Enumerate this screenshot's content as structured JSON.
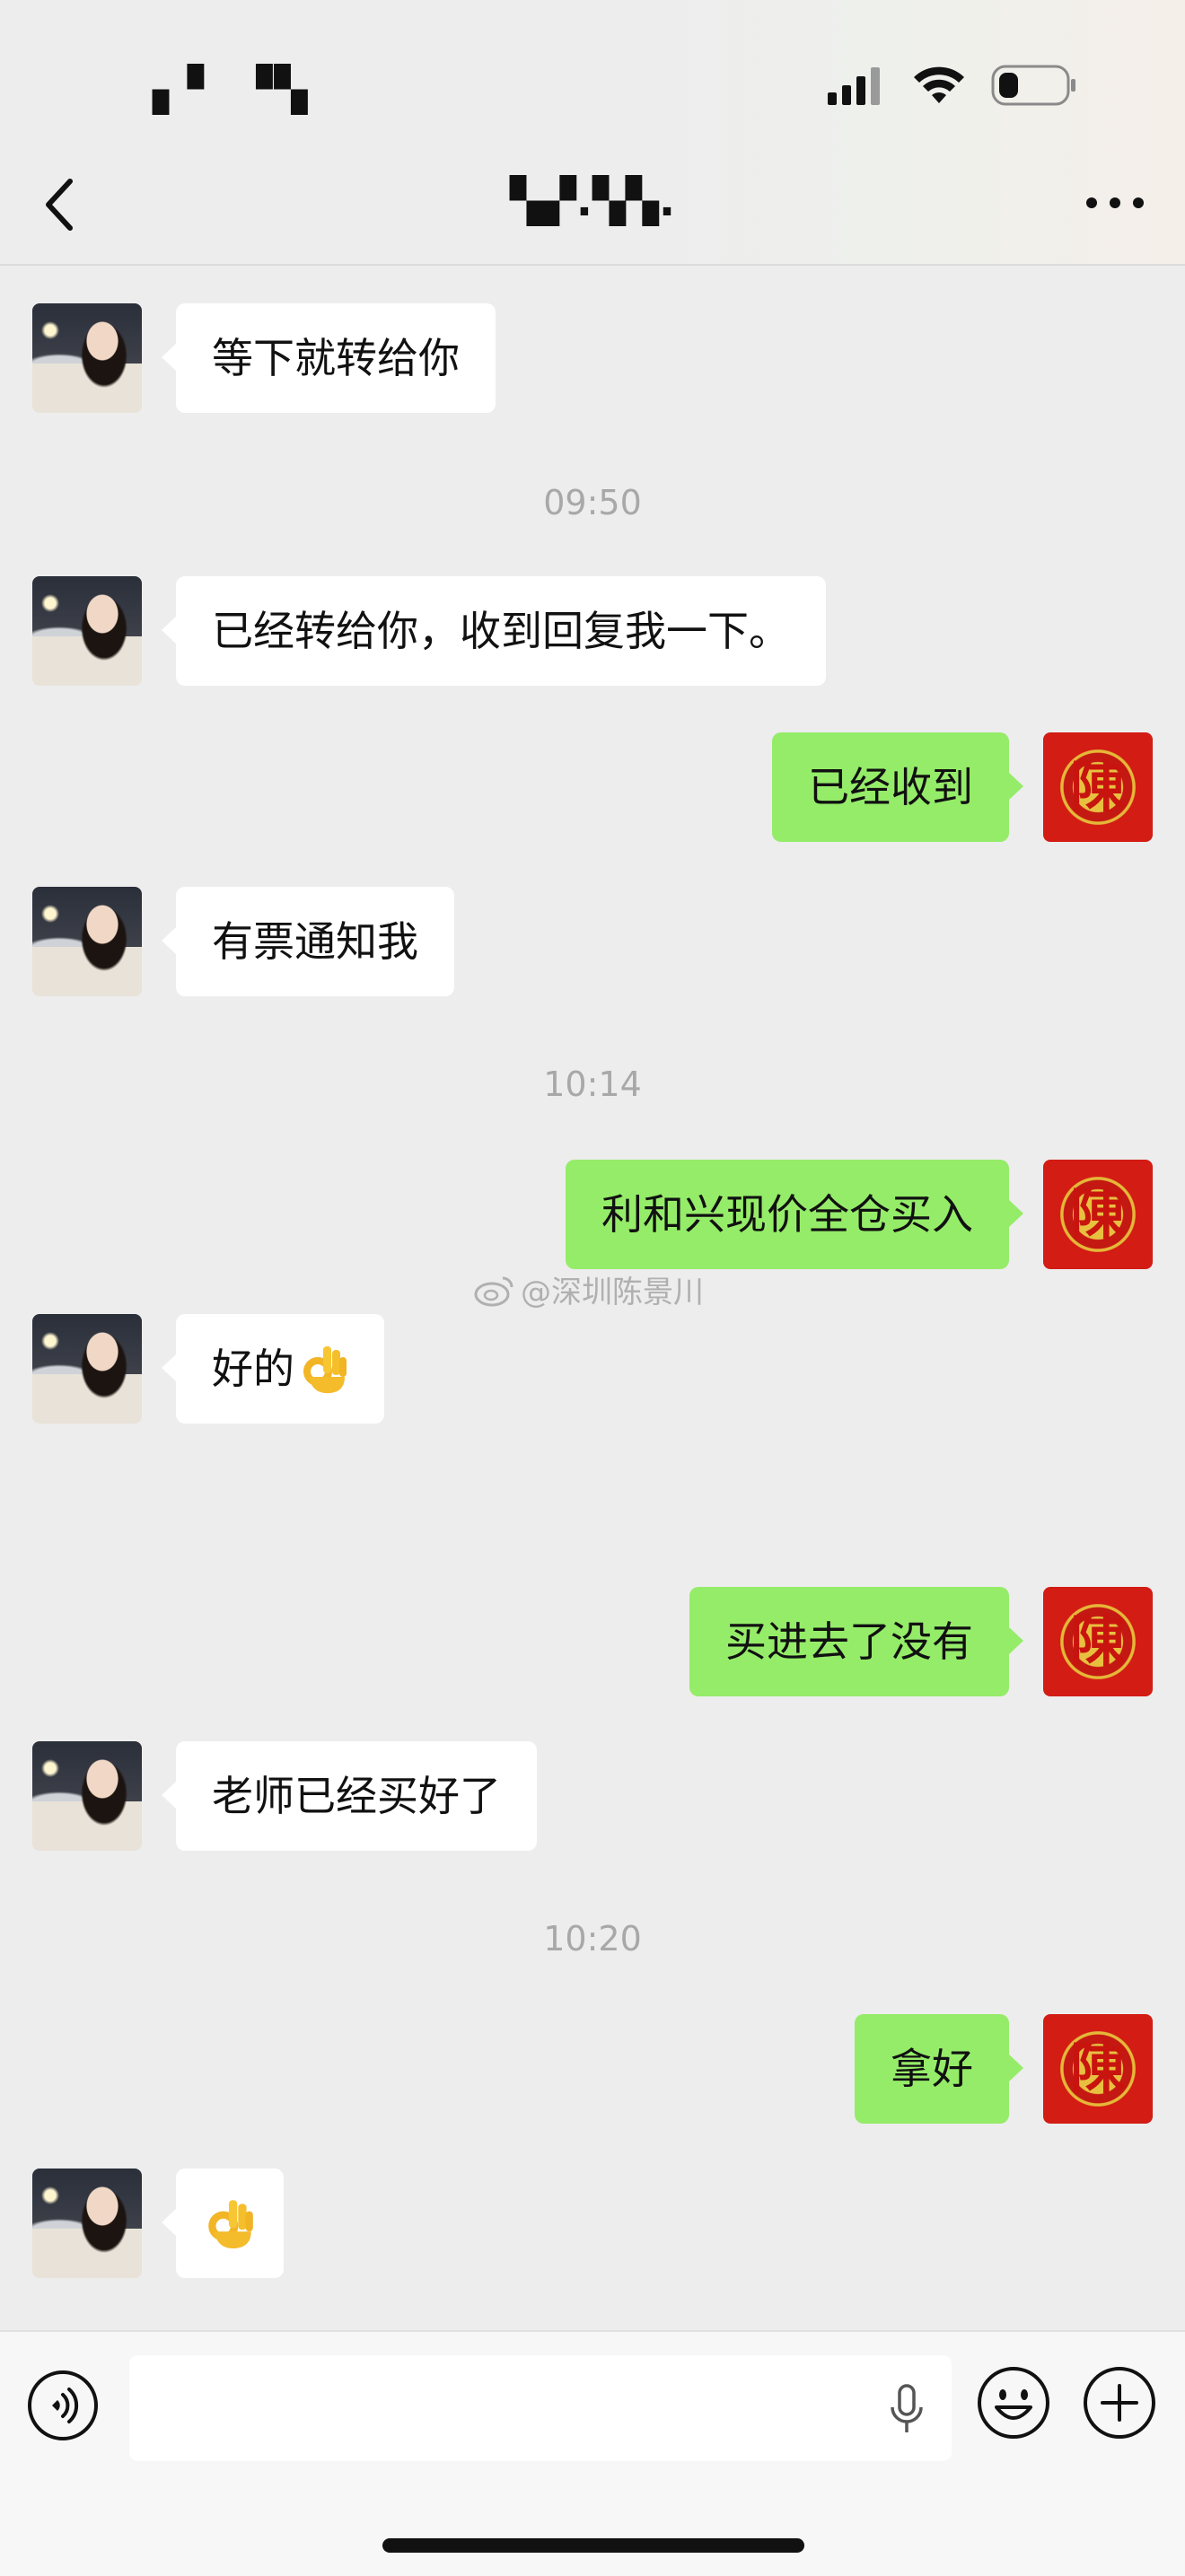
{
  "status_bar": {
    "time": "▖▘ ▝▚",
    "battery_level_percent": 30
  },
  "header": {
    "title": "▚▞.▚▚.",
    "back_icon": "chevron-left-icon",
    "more_icon": "ellipsis-icon"
  },
  "messages": [
    {
      "side": "in",
      "text": "等下就转给你"
    },
    {
      "timestamp": "09:50"
    },
    {
      "side": "in",
      "text": "已经转给你，收到回复我一下。"
    },
    {
      "side": "out",
      "text": "已经收到"
    },
    {
      "side": "in",
      "text": "有票通知我"
    },
    {
      "timestamp": "10:14"
    },
    {
      "side": "out",
      "text": "利和兴现价全仓买入"
    },
    {
      "side": "in",
      "text": "好的",
      "emoji": "ok-hand"
    },
    {
      "side": "out",
      "text": "买进去了没有"
    },
    {
      "side": "in",
      "text": "老师已经买好了"
    },
    {
      "timestamp": "10:20"
    },
    {
      "side": "out",
      "text": "拿好"
    },
    {
      "side": "in",
      "emoji": "ok-hand"
    }
  ],
  "avatars": {
    "self_avatar_glyph": "陳"
  },
  "watermark": "@深圳陈景川",
  "input_bar": {
    "voice_icon": "voice-icon",
    "mic_icon": "microphone-icon",
    "emoji_icon": "smiley-icon",
    "plus_icon": "plus-icon"
  },
  "colors": {
    "background": "#ededed",
    "incoming_bubble": "#ffffff",
    "outgoing_bubble": "#95ec69",
    "timestamp_text": "#a8a8a8"
  }
}
